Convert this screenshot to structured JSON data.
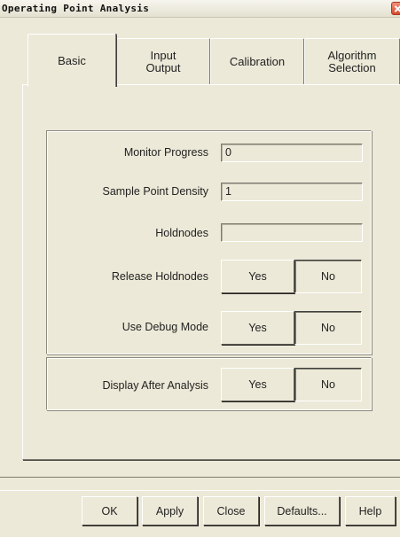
{
  "window": {
    "title": "Operating Point Analysis"
  },
  "tabs": [
    {
      "label": "Basic",
      "active": true
    },
    {
      "label": "Input\nOutput",
      "active": false
    },
    {
      "label": "Calibration",
      "active": false
    },
    {
      "label": "Algorithm\nSelection",
      "active": false
    }
  ],
  "fields": {
    "monitor_progress": {
      "label": "Monitor Progress",
      "value": "0"
    },
    "sample_point_density": {
      "label": "Sample Point Density",
      "value": "1"
    },
    "holdnodes": {
      "label": "Holdnodes",
      "value": ""
    }
  },
  "toggles": {
    "release_holdnodes": {
      "label": "Release Holdnodes",
      "yes": "Yes",
      "no": "No",
      "selected": "Yes"
    },
    "use_debug_mode": {
      "label": "Use Debug Mode",
      "yes": "Yes",
      "no": "No",
      "selected": "Yes"
    },
    "display_after_analysis": {
      "label": "Display After Analysis",
      "yes": "Yes",
      "no": "No",
      "selected": "Yes"
    }
  },
  "buttons": {
    "ok": "OK",
    "apply": "Apply",
    "close": "Close",
    "defaults": "Defaults...",
    "help": "Help"
  },
  "colors": {
    "face": "#ece9d8",
    "close_button": "#d6492c"
  }
}
